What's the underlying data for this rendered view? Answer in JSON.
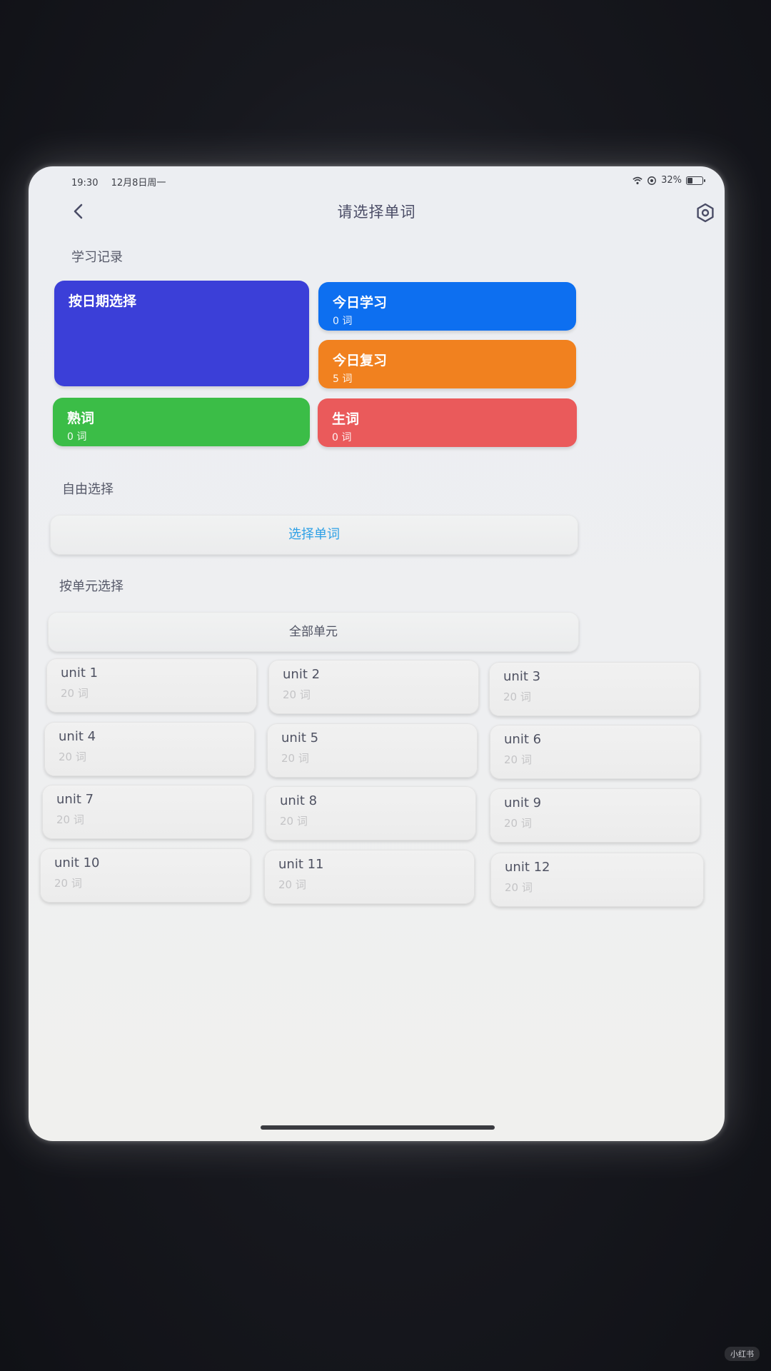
{
  "status_bar": {
    "time": "19:30",
    "date": "12月8日周一",
    "battery": "32%"
  },
  "header": {
    "title": "请选择单词",
    "back_icon": "chevron-left-icon",
    "settings_icon": "gear-icon"
  },
  "record_section": {
    "label": "学习记录",
    "tiles": [
      {
        "title": "按日期选择",
        "subtitle": "",
        "color": "#3b3fd8"
      },
      {
        "title": "今日学习",
        "subtitle": "0 词",
        "color": "#0d6ff0"
      },
      {
        "title": "今日复习",
        "subtitle": "5 词",
        "color": "#f1811f"
      },
      {
        "title": "熟词",
        "subtitle": "0 词",
        "color": "#3bbd47"
      },
      {
        "title": "生词",
        "subtitle": "0 词",
        "color": "#ea5a5b"
      }
    ]
  },
  "free_section": {
    "label": "自由选择",
    "button": "选择单词",
    "button_color": "#2ea0e6"
  },
  "unit_section": {
    "label": "按单元选择",
    "all_button": "全部单元",
    "units": [
      {
        "name": "unit 1",
        "count": "20 词"
      },
      {
        "name": "unit 2",
        "count": "20 词"
      },
      {
        "name": "unit 3",
        "count": "20 词"
      },
      {
        "name": "unit 4",
        "count": "20 词"
      },
      {
        "name": "unit 5",
        "count": "20 词"
      },
      {
        "name": "unit 6",
        "count": "20 词"
      },
      {
        "name": "unit 7",
        "count": "20 词"
      },
      {
        "name": "unit 8",
        "count": "20 词"
      },
      {
        "name": "unit 9",
        "count": "20 词"
      },
      {
        "name": "unit 10",
        "count": "20 词"
      },
      {
        "name": "unit 11",
        "count": "20 词"
      },
      {
        "name": "unit 12",
        "count": "20 词"
      }
    ]
  },
  "watermark": "小红书"
}
